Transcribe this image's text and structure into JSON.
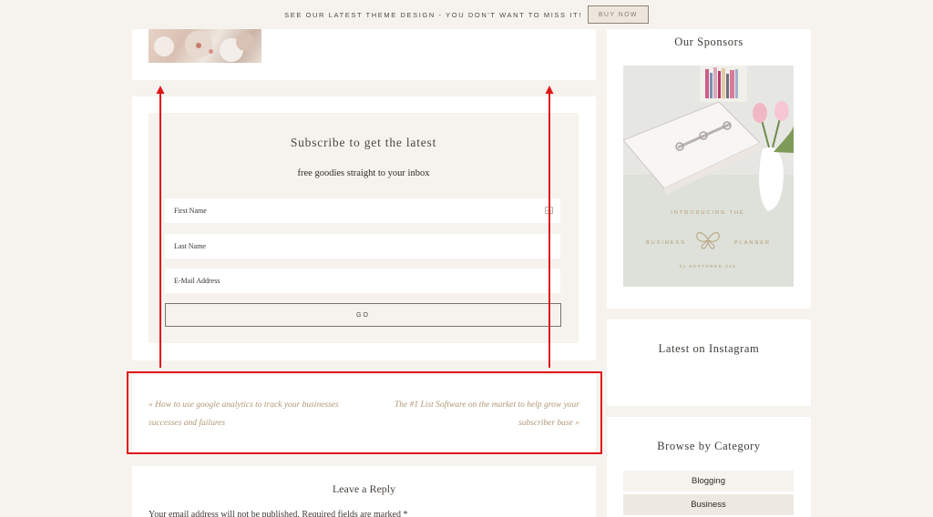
{
  "topbar": {
    "message": "SEE OUR LATEST THEME DESIGN - YOU DON'T WANT TO MISS IT!",
    "button": "BUY NOW"
  },
  "subscribe": {
    "title": "Subscribe to get the latest",
    "subtitle": "free goodies straight to your inbox",
    "first_name_placeholder": "First Name",
    "last_name_placeholder": "Last Name",
    "email_placeholder": "E-Mail Address",
    "go_label": "GO"
  },
  "post_nav": {
    "prev_line1": "« How to use google analytics to track your businesses",
    "prev_line2": "successes and failures",
    "next_line1": "The #1 List Software on the market to help grow your",
    "next_line2": "subscriber base »"
  },
  "reply": {
    "title": "Leave a Reply",
    "note": "Your email address will not be published. Required fields are marked *"
  },
  "sidebar": {
    "sponsors_title": "Our Sponsors",
    "sponsor_ad": {
      "line1": "INTRODUCING THE",
      "line2_left": "BUSINESS",
      "line2_right": "PLANNER",
      "line3": "by RESTORED 316"
    },
    "instagram_title": "Latest on Instagram",
    "category_title": "Browse by Category",
    "categories": [
      "Blogging",
      "Business"
    ]
  },
  "colors": {
    "highlight": "#e0161b",
    "link": "#b09774",
    "page_bg": "#f6f3ee"
  },
  "icons": {
    "contact_card": "contact-card-icon",
    "butterfly": "butterfly-logo-icon"
  }
}
